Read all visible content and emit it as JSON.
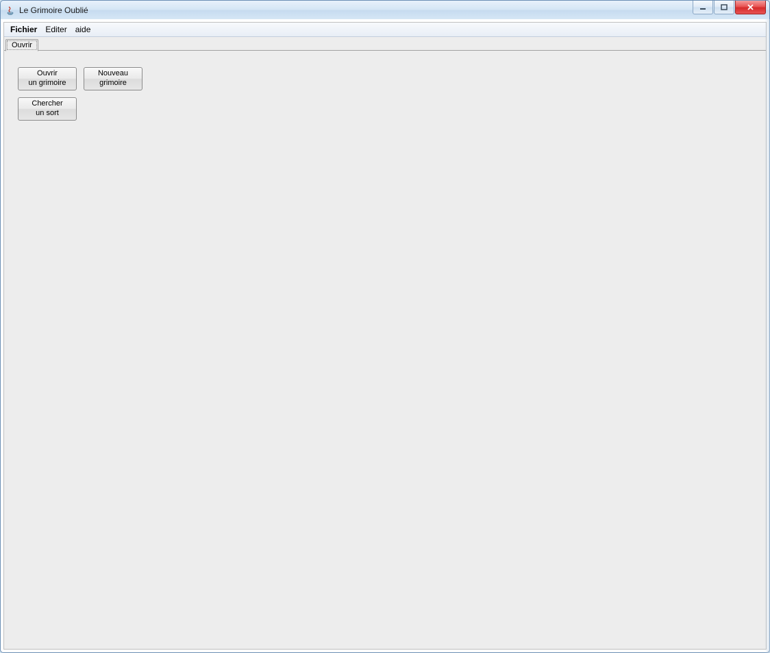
{
  "window": {
    "title": "Le Grimoire Oublié"
  },
  "menubar": {
    "items": [
      {
        "label": "Fichier"
      },
      {
        "label": "Editer"
      },
      {
        "label": "aide"
      }
    ]
  },
  "tabs": [
    {
      "label": "Ouvrir"
    }
  ],
  "actions": {
    "open_grimoire": {
      "line1": "Ouvrir",
      "line2": "un grimoire"
    },
    "new_grimoire": {
      "line1": "Nouveau",
      "line2": "grimoire"
    },
    "search_spell": {
      "line1": "Chercher",
      "line2": "un sort"
    }
  }
}
